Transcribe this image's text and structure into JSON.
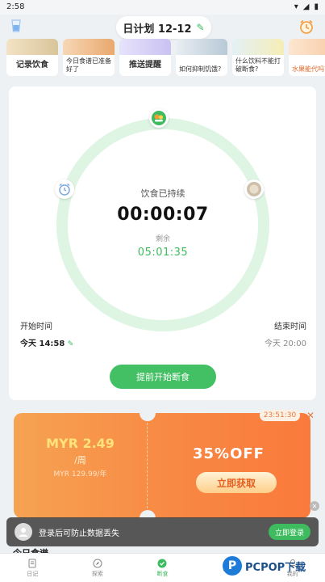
{
  "status": {
    "time": "2:58"
  },
  "header": {
    "plan_title": "日计划 12-12"
  },
  "cards": [
    {
      "label": "记录饮食"
    },
    {
      "label": "今日食谱已准备好了"
    },
    {
      "label": "推送提醒"
    },
    {
      "label": "如何抑制饥饿?"
    },
    {
      "label": "什么饮料不能打破断食?"
    },
    {
      "label": "水果能代吗?"
    }
  ],
  "timer": {
    "elapsed_label": "饮食已持续",
    "elapsed": "00:00:07",
    "remaining_label": "剩余",
    "remaining": "05:01:35",
    "progress": 0.0
  },
  "times": {
    "start_label": "开始时间",
    "start_value": "今天 14:58",
    "end_label": "结束时间",
    "end_value": "今天 20:00"
  },
  "cta": {
    "label": "提前开始断食"
  },
  "promo": {
    "price": "MYR 2.49",
    "period": "/周",
    "original": "MYR 129.99/年",
    "discount": "35%OFF",
    "button": "立即获取",
    "countdown": "23:51:30"
  },
  "login": {
    "message": "登录后可防止数据丢失",
    "button": "立即登录"
  },
  "peek": {
    "title": "今日食谱"
  },
  "nav": [
    {
      "label": "日记"
    },
    {
      "label": "探索"
    },
    {
      "label": "断食"
    },
    {
      "label": ""
    },
    {
      "label": "我的"
    }
  ],
  "watermark": {
    "text": "PCPOP下载"
  },
  "colors": {
    "accent": "#3dbb5e",
    "ring": "#dff5e4",
    "promo_start": "#f6a353",
    "promo_end": "#fa7a3c"
  }
}
